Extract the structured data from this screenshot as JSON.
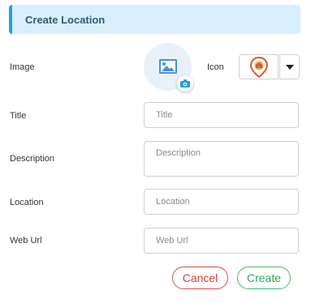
{
  "header": {
    "title": "Create Location"
  },
  "form": {
    "image_label": "Image",
    "icon_label": "Icon",
    "title_label": "Title",
    "title_placeholder": "Title",
    "description_label": "Description",
    "description_placeholder": "Description",
    "location_label": "Location",
    "location_placeholder": "Location",
    "weburl_label": "Web Url",
    "weburl_placeholder": "Web Url"
  },
  "buttons": {
    "cancel": "Cancel",
    "create": "Create"
  },
  "icons": {
    "image_placeholder": "image-icon",
    "camera": "camera-icon",
    "selected_icon": "map-pin-icon",
    "dropdown": "caret-down-icon"
  },
  "colors": {
    "accent": "#1fa2e0",
    "header_bg": "#d8eefb",
    "cancel": "#d93b3b",
    "create": "#2eaa58"
  }
}
